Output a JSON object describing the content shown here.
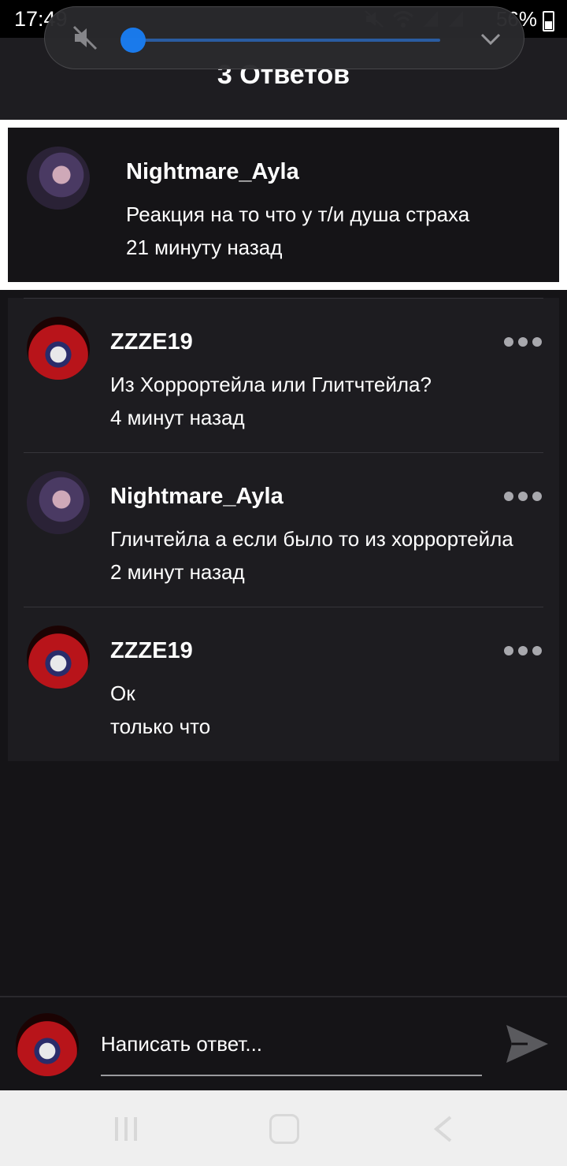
{
  "status_bar": {
    "time": "17:49",
    "battery": "56%"
  },
  "volume_panel": {
    "level": 0.0
  },
  "header": {
    "title": "3 Ответов"
  },
  "parent_comment": {
    "author": "Nightmare_Ayla",
    "text": "Реакция на то что у т/и душа страха",
    "time": "21 минуту назад",
    "avatar_icon": "user-avatar-purple"
  },
  "replies": [
    {
      "author": "ZZZE19",
      "text": "Из Хоррортейла или Глитчтейла?",
      "time": "4 минут назад",
      "avatar_icon": "user-avatar-red"
    },
    {
      "author": "Nightmare_Ayla",
      "text": "Гличтейла а если было то из хоррортейла",
      "time": "2 минут назад",
      "avatar_icon": "user-avatar-purple"
    },
    {
      "author": "ZZZE19",
      "text": "Ок",
      "time": "только что",
      "avatar_icon": "user-avatar-red"
    }
  ],
  "composer": {
    "placeholder": "Написать ответ...",
    "send_icon": "send-icon"
  },
  "colors": {
    "accent": "#1a7df2",
    "background": "#151417",
    "card": "#1d1c20"
  }
}
